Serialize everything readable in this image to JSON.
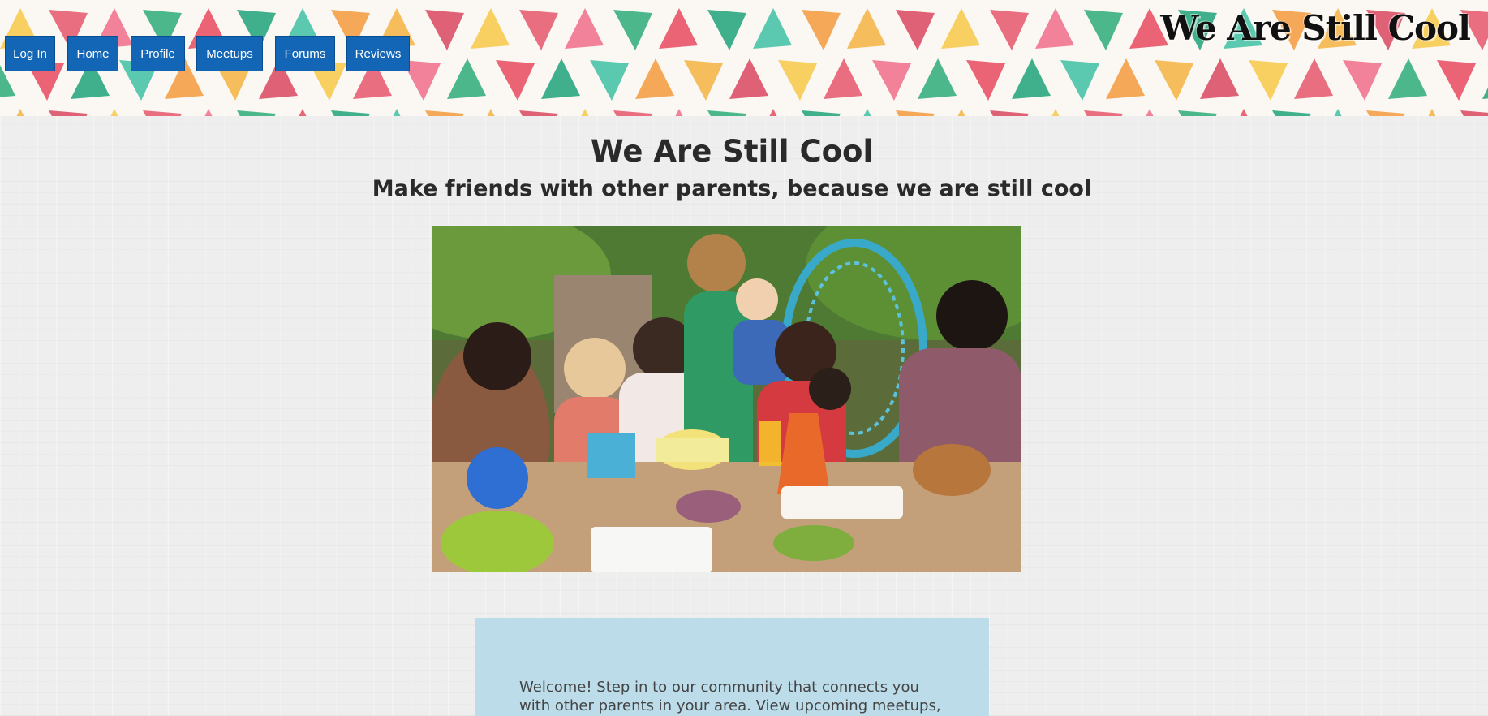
{
  "nav": {
    "items": [
      {
        "label": "Log In"
      },
      {
        "label": "Home"
      },
      {
        "label": "Profile"
      },
      {
        "label": "Meetups"
      },
      {
        "label": "Forums"
      },
      {
        "label": "Reviews"
      }
    ]
  },
  "header": {
    "brand": "We Are Still Cool"
  },
  "main": {
    "title": "We Are Still Cool",
    "subtitle": "Make friends with other parents, because we are still cool",
    "hero_image_icon": "family-party-photo",
    "welcome_text": "Welcome! Step in to our community that connects you with other parents in your area. View upcoming meetups,"
  },
  "colors": {
    "nav_button": "#1266b5",
    "welcome_box": "#bcdcea",
    "page_background": "#eeeeee"
  }
}
